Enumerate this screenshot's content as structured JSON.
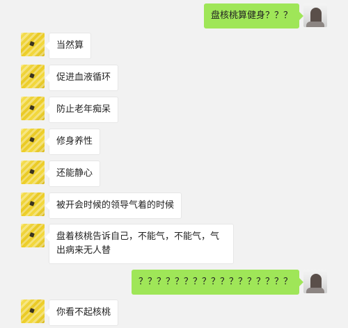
{
  "messages": [
    {
      "side": "right",
      "text": "盘核桃算健身？？？"
    },
    {
      "side": "left",
      "text": "当然算"
    },
    {
      "side": "left",
      "text": "促进血液循环"
    },
    {
      "side": "left",
      "text": "防止老年痴呆"
    },
    {
      "side": "left",
      "text": "修身养性"
    },
    {
      "side": "left",
      "text": "还能静心"
    },
    {
      "side": "left",
      "text": "被开会时候的领导气着的时候"
    },
    {
      "side": "left",
      "text": "盘着核桃告诉自己，不能气，不能气，气出病来无人替"
    },
    {
      "side": "right",
      "text": "？？？？？？？？？？？？？？？？？"
    },
    {
      "side": "left",
      "text": "你看不起核桃"
    }
  ],
  "colors": {
    "sent_bubble": "#9fe658",
    "received_bubble": "#ffffff",
    "background": "#f2f2f2"
  },
  "avatars": {
    "contact": "corn-avatar",
    "self": "user-photo-avatar"
  }
}
